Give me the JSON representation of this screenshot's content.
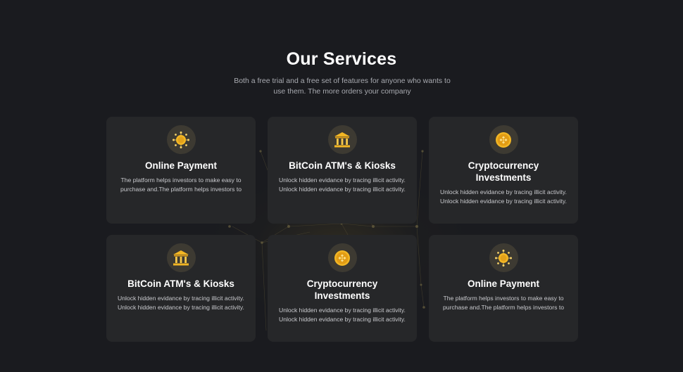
{
  "section": {
    "title": "Our Services",
    "subtitle": "Both a free trial and a free set of features for anyone who wants to use them. The more orders your company"
  },
  "cards": [
    {
      "icon": "coin-network-icon",
      "title": "Online Payment",
      "description": "The platform helps investors to make easy to purchase and.The platform helps investors to"
    },
    {
      "icon": "bank-building-icon",
      "title": "BitCoin ATM's & Kiosks",
      "description": "Unlock hidden evidance by tracing illicit activity. Unlock hidden evidance by tracing illicit activity."
    },
    {
      "icon": "binance-coin-icon",
      "title": "Cryptocurrency Investments",
      "description": "Unlock hidden evidance by tracing illicit activity. Unlock hidden evidance by tracing illicit activity."
    },
    {
      "icon": "bank-building-icon",
      "title": "BitCoin ATM's & Kiosks",
      "description": "Unlock hidden evidance by tracing illicit activity. Unlock hidden evidance by tracing illicit activity."
    },
    {
      "icon": "binance-coin-icon",
      "title": "Cryptocurrency Investments",
      "description": "Unlock hidden evidance by tracing illicit activity. Unlock hidden evidance by tracing illicit activity."
    },
    {
      "icon": "coin-network-icon",
      "title": "Online Payment",
      "description": "The platform helps investors to make easy to purchase and.The platform helps investors to"
    }
  ],
  "colors": {
    "background": "#1a1b1f",
    "card": "#262729",
    "icon_circle": "#3d3a32",
    "gold": "#f2b624"
  }
}
